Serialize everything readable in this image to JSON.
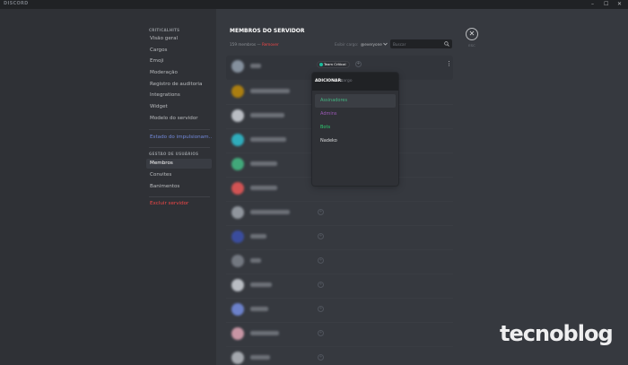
{
  "window": {
    "title": "DISCORD",
    "controls": {
      "minimize": "–",
      "maximize": "☐",
      "close": "✕"
    }
  },
  "sidebar": {
    "section_server": "CRITICALHITS",
    "items_server": [
      {
        "label": "Visão geral"
      },
      {
        "label": "Cargos"
      },
      {
        "label": "Emoji"
      },
      {
        "label": "Moderação"
      },
      {
        "label": "Registro de auditoria"
      },
      {
        "label": "Integrations"
      },
      {
        "label": "Widget"
      },
      {
        "label": "Modelo do servidor"
      }
    ],
    "boost_link": "Estado do impulsionam...",
    "section_users": "GESTÃO DE USUÁRIOS",
    "items_users": [
      {
        "label": "Membros",
        "active": true
      },
      {
        "label": "Convites"
      },
      {
        "label": "Banimentos"
      }
    ],
    "delete_server": "Excluir servidor"
  },
  "main": {
    "title": "MEMBROS DO SERVIDOR",
    "member_count": "159 membros",
    "separator": "—",
    "prune_label": "Remover",
    "filter_label": "Exibir cargo:",
    "filter_value": "@everyone",
    "search_placeholder": "Buscar",
    "esc_label": "ESC",
    "members": [
      {
        "avatar_color": "#8e9aa8",
        "role": {
          "name": "Team Critical",
          "color": "#1abc9c"
        },
        "add": "+"
      },
      {
        "avatar_color": "#b8860b"
      },
      {
        "avatar_color": "#c8ccd2"
      },
      {
        "avatar_color": "#2fb9c9"
      },
      {
        "avatar_color": "#43b581"
      },
      {
        "avatar_color": "#e25656"
      },
      {
        "avatar_color": "#9aa0a8",
        "add": "+"
      },
      {
        "avatar_color": "#3b4fa8",
        "add": "+"
      },
      {
        "avatar_color": "#7a7f88",
        "add": "+"
      },
      {
        "avatar_color": "#c8ccd2",
        "add": "+"
      },
      {
        "avatar_color": "#7289da",
        "add": "+"
      },
      {
        "avatar_color": "#d8a0b0",
        "add": "+"
      },
      {
        "avatar_color": "#b0b4ba",
        "add": "+"
      }
    ]
  },
  "role_popup": {
    "label": "ADICIONAR:",
    "placeholder": "Cargo",
    "options": [
      {
        "name": "Assinadores",
        "color": "#43b581",
        "selected": true
      },
      {
        "name": "Admins",
        "color": "#9b59b6"
      },
      {
        "name": "Bots",
        "color": "#2ecc71"
      },
      {
        "name": "Nadeko",
        "color": "#dcddde"
      }
    ]
  },
  "watermark": "tecnoblog"
}
